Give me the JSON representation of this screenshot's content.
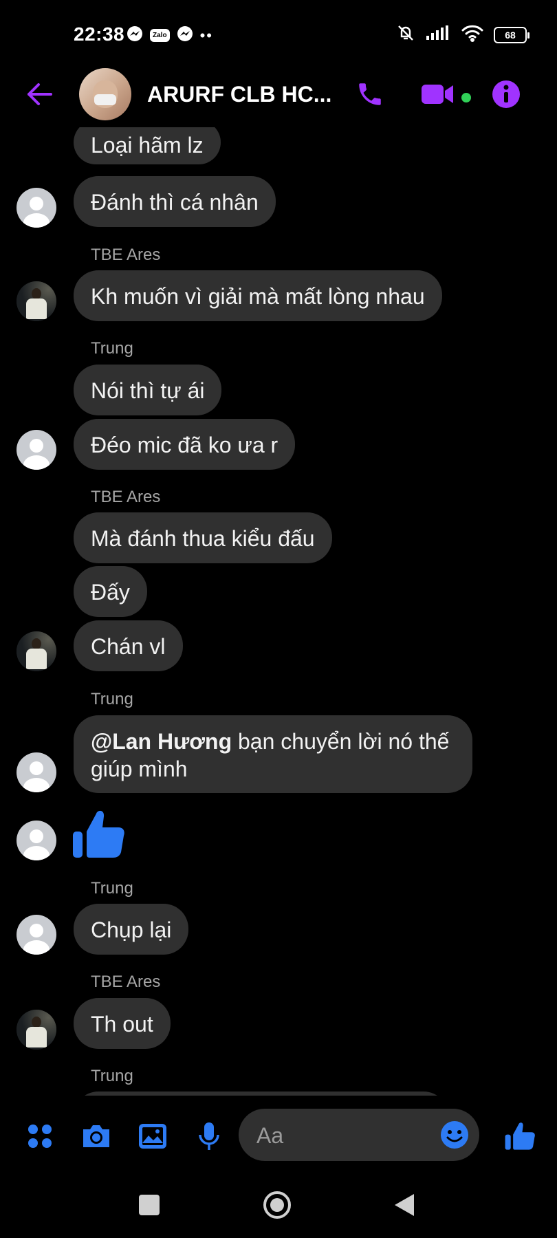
{
  "status_bar": {
    "time": "22:38",
    "zalo_label": "Zalo",
    "overflow": "••",
    "battery": "68",
    "icons": [
      "messenger-icon",
      "zalo-icon",
      "messenger-icon",
      "mute-bell-icon",
      "signal-icon",
      "wifi-icon",
      "battery-icon"
    ]
  },
  "header": {
    "title": "ARURF CLB HC...",
    "accent_color": "#a033ff",
    "online_color": "#31d158",
    "buttons": [
      "back-arrow-icon",
      "phone-icon",
      "video-call-icon",
      "info-icon"
    ]
  },
  "messages": [
    {
      "text": "Loại hãm lz"
    },
    {
      "text": "Đánh thì cá nhân"
    },
    {
      "sender": "TBE Ares"
    },
    {
      "text": "Kh muốn vì giải mà mất lòng nhau"
    },
    {
      "sender": "Trung"
    },
    {
      "text": "Nói thì tự ái"
    },
    {
      "text": "Đéo mic đã ko ưa r"
    },
    {
      "sender": "TBE Ares"
    },
    {
      "text": "Mà đánh thua kiểu đấu"
    },
    {
      "text": "Đấy"
    },
    {
      "text": "Chán vl"
    },
    {
      "sender": "Trung"
    },
    {
      "mention": "@Lan Hương",
      "line1": " bạn chuyển lời nó thế",
      "line2": "giúp mình"
    },
    {
      "like": "thumbs-up-icon"
    },
    {
      "sender": "Trung"
    },
    {
      "text": "Chụp lại"
    },
    {
      "sender": "TBE Ares"
    },
    {
      "text": "Th out"
    },
    {
      "sender": "Trung"
    }
  ],
  "composer": {
    "placeholder": "Aa",
    "brand_color": "#2d7bf4",
    "buttons": [
      "apps-grid-icon",
      "camera-icon",
      "gallery-icon",
      "microphone-icon",
      "emoji-icon",
      "thumbs-up-icon"
    ]
  },
  "navbar": {
    "buttons": [
      "recents-square-icon",
      "home-circle-icon",
      "back-triangle-icon"
    ]
  }
}
